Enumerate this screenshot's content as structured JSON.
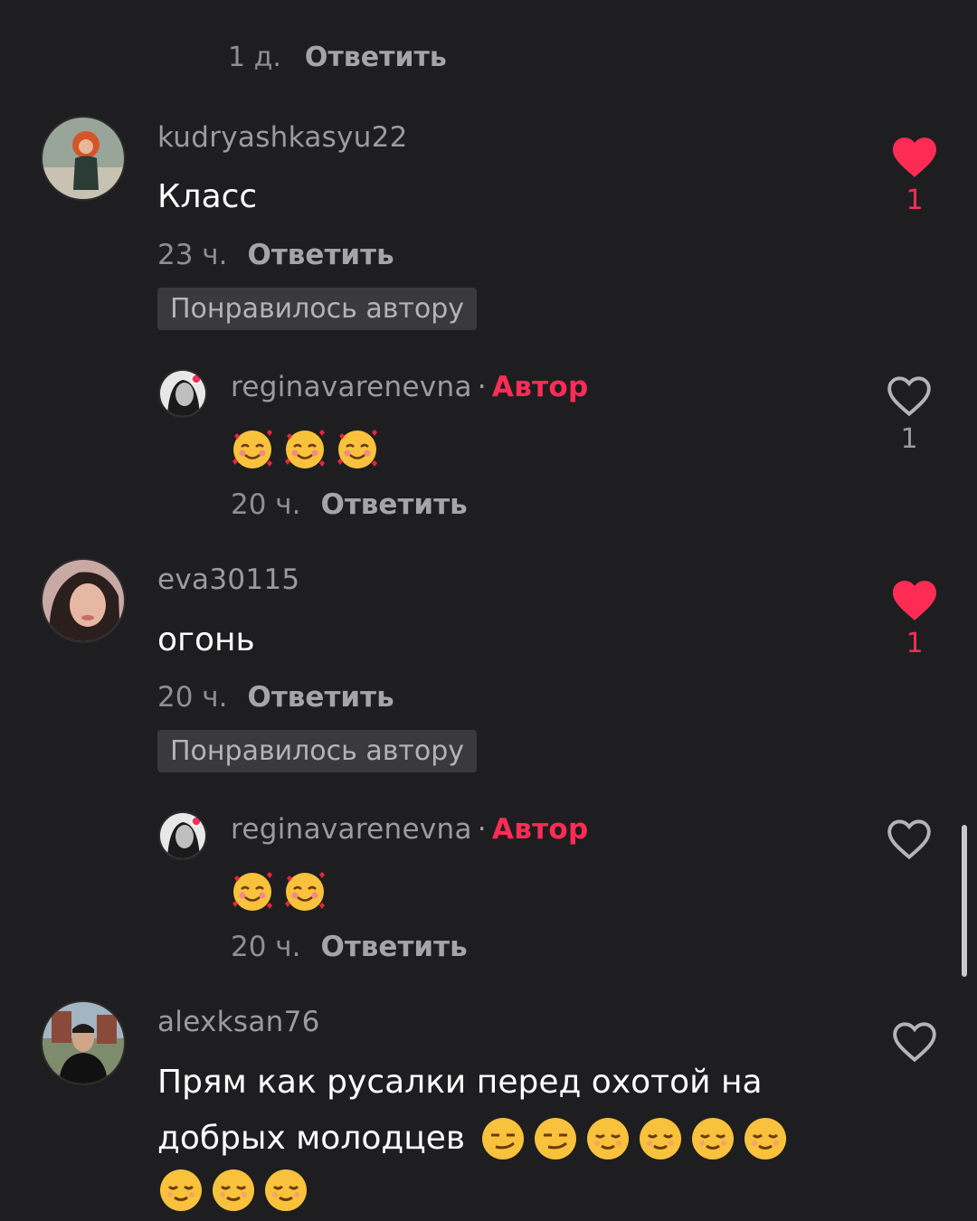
{
  "colors": {
    "background": "#1e1e20",
    "accent_red": "#fe2c55",
    "muted_text": "#9b9b9f",
    "badge_bg": "#3a3a3c"
  },
  "top_meta": {
    "time": "1 д.",
    "reply": "Ответить"
  },
  "comments": [
    {
      "username": "kudryashkasyu22",
      "text": "Класс",
      "time": "23 ч.",
      "reply": "Ответить",
      "liked_by_author": "Понравилось автору",
      "likes": "1",
      "liked": true,
      "avatar": "avatar-red-hair-woman"
    },
    {
      "username": "reginavarenevna",
      "dot": "·",
      "author_label": "Автор",
      "emojis": [
        "smiling-face-with-hearts",
        "smiling-face-with-hearts",
        "smiling-face-with-hearts"
      ],
      "time": "20 ч.",
      "reply": "Ответить",
      "likes": "1",
      "liked": false,
      "avatar": "avatar-bw-woman"
    },
    {
      "username": "eva30115",
      "text": "огонь",
      "time": "20 ч.",
      "reply": "Ответить",
      "liked_by_author": "Понравилось автору",
      "likes": "1",
      "liked": true,
      "avatar": "avatar-woman-dark-hair"
    },
    {
      "username": "reginavarenevna",
      "dot": "·",
      "author_label": "Автор",
      "emojis": [
        "smiling-face-with-hearts",
        "smiling-face-with-hearts"
      ],
      "time": "20 ч.",
      "reply": "Ответить",
      "liked": false,
      "avatar": "avatar-bw-woman"
    },
    {
      "username": "alexksan76",
      "text_line1": "Прям как русалки перед охотой на",
      "text_line2": "добрых молодцев",
      "emojis_line2": [
        "smirking-face",
        "smirking-face",
        "relieved-face",
        "relieved-face",
        "relieved-face",
        "relieved-face"
      ],
      "emojis_line3": [
        "relieved-face",
        "relieved-face",
        "relieved-face"
      ],
      "liked": false,
      "avatar": "avatar-man-dark-sweater"
    }
  ]
}
